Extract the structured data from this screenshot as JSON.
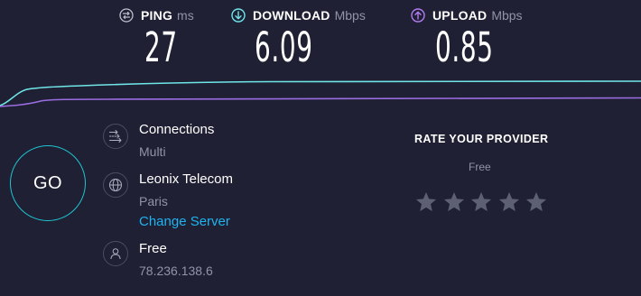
{
  "metrics": {
    "ping": {
      "label": "PING",
      "unit": "ms",
      "value": "27",
      "icon": "ping-icon"
    },
    "download": {
      "label": "DOWNLOAD",
      "unit": "Mbps",
      "value": "6.09",
      "icon": "download-arrow-icon"
    },
    "upload": {
      "label": "UPLOAD",
      "unit": "Mbps",
      "value": "0.85",
      "icon": "upload-arrow-icon"
    }
  },
  "colors": {
    "background": "#1f2033",
    "download_line": "#6fe5e8",
    "upload_line": "#9b6de3",
    "go_ring": "#1fc4d2",
    "link": "#1fb3f0",
    "muted_text": "#9193a8",
    "star": "#5d6073"
  },
  "go_button": {
    "label": "GO"
  },
  "connections": {
    "title": "Connections",
    "value": "Multi",
    "icon": "connections-icon"
  },
  "server": {
    "name": "Leonix Telecom",
    "location": "Paris",
    "change_label": "Change Server",
    "icon": "globe-icon"
  },
  "user": {
    "provider": "Free",
    "ip": "78.236.138.6",
    "icon": "user-icon"
  },
  "rating": {
    "title": "RATE YOUR PROVIDER",
    "provider": "Free",
    "stars": [
      {
        "label": "1"
      },
      {
        "label": "2"
      },
      {
        "label": "3"
      },
      {
        "label": "4"
      },
      {
        "label": "5"
      }
    ]
  }
}
